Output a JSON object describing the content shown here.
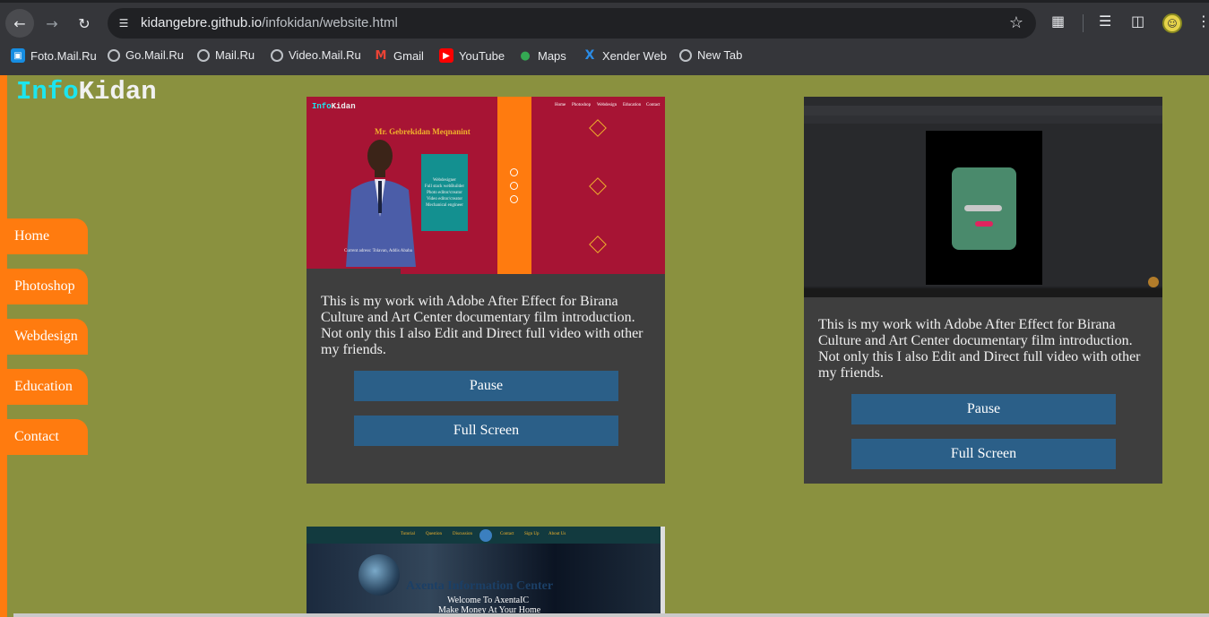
{
  "browser": {
    "url_host": "kidangebre.github.io",
    "url_path": "/infokidan/website.html",
    "bookmarks": [
      {
        "label": "Foto.Mail.Ru",
        "icon": "foto-mail-icon"
      },
      {
        "label": "Go.Mail.Ru",
        "icon": "globe-icon"
      },
      {
        "label": "Mail.Ru",
        "icon": "globe-icon"
      },
      {
        "label": "Video.Mail.Ru",
        "icon": "globe-icon"
      },
      {
        "label": "Gmail",
        "icon": "gmail-icon"
      },
      {
        "label": "YouTube",
        "icon": "youtube-icon"
      },
      {
        "label": "Maps",
        "icon": "maps-icon"
      },
      {
        "label": "Xender Web",
        "icon": "xender-icon"
      },
      {
        "label": "New Tab",
        "icon": "globe-icon"
      }
    ]
  },
  "site": {
    "logo_part1": "Info",
    "logo_part2": "Kidan",
    "nav": [
      "Home",
      "Photoshop",
      "Webdesign",
      "Education",
      "Contact"
    ]
  },
  "cards": [
    {
      "description": "This is my work with Adobe After Effect for Birana Culture and Art Center documentary film introduction. Not only this I also Edit and Direct full video with other my friends.",
      "pause_label": "Pause",
      "fullscreen_label": "Full Screen"
    },
    {
      "description": "This is my work with Adobe After Effect for Birana Culture and Art Center documentary film introduction. Not only this I also Edit and Direct full video with other my friends.",
      "pause_label": "Pause",
      "fullscreen_label": "Full Screen"
    }
  ],
  "thumb1": {
    "logo_a": "Info",
    "logo_b": "Kidan",
    "name": "Mr. Gebrekidan Meqnanint",
    "nav": [
      "Home",
      "Photoshop",
      "Webdesign",
      "Education",
      "Contact"
    ],
    "box_lines": [
      "Webdesigner",
      "Full stack webBuilder",
      "Photo editor/creator",
      "Video editor/creator",
      "Mechanical engineer"
    ],
    "caption": "Current adress: Tolavan, Addis Ababa"
  },
  "thumb3": {
    "nav": [
      "Tutorial",
      "Question",
      "Discussion",
      "Contact",
      "Sign Up",
      "About Us"
    ],
    "title": "Axenta Information Center",
    "sub1": "Welcome To AxentaIC",
    "sub2": "Make Money At Your Home"
  },
  "colors": {
    "page_bg": "#8a913f",
    "accent_orange": "#ff7b0f",
    "card_bg": "#3e3e3e",
    "button_bg": "#2b5f88",
    "logo_cyan": "#1de5ee"
  }
}
